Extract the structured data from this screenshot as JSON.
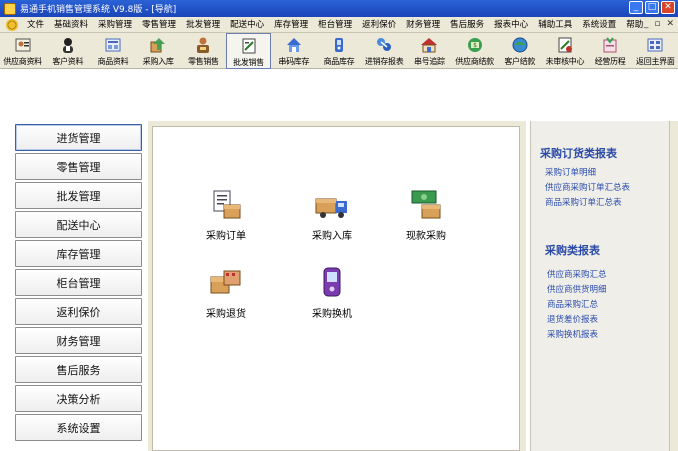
{
  "window": {
    "title": "易通手机销售管理系统  V9.8版 - [导航]"
  },
  "menu": [
    "文件",
    "基础资料",
    "采购管理",
    "零售管理",
    "批发管理",
    "配送中心",
    "库存管理",
    "柜台管理",
    "返利保价",
    "财务管理",
    "售后服务",
    "报表中心",
    "辅助工具",
    "系统设置",
    "帮助"
  ],
  "toolbar": [
    {
      "label": "供应商资料",
      "icon": "supplier-icon"
    },
    {
      "label": "客户资料",
      "icon": "customer-icon"
    },
    {
      "label": "商品资料",
      "icon": "product-icon"
    },
    {
      "label": "采购入库",
      "icon": "purchase-in-icon"
    },
    {
      "label": "零售销售",
      "icon": "retail-icon"
    },
    {
      "label": "批发销售",
      "icon": "wholesale-icon"
    },
    {
      "label": "串码库存",
      "icon": "serial-stock-icon"
    },
    {
      "label": "商品库存",
      "icon": "stock-icon"
    },
    {
      "label": "进销存报表",
      "icon": "report-icon"
    },
    {
      "label": "串号追踪",
      "icon": "serial-track-icon"
    },
    {
      "label": "供应商结款",
      "icon": "supplier-pay-icon"
    },
    {
      "label": "客户结款",
      "icon": "customer-pay-icon"
    },
    {
      "label": "未审核中心",
      "icon": "unaudited-icon"
    },
    {
      "label": "经营历程",
      "icon": "history-icon"
    },
    {
      "label": "返回主界面",
      "icon": "home-icon"
    }
  ],
  "nav": [
    "进货管理",
    "零售管理",
    "批发管理",
    "配送中心",
    "库存管理",
    "柜台管理",
    "返利保价",
    "财务管理",
    "售后服务",
    "决策分析",
    "系统设置"
  ],
  "functions": [
    {
      "label": "采购订单",
      "icon": "purchase-order-icon"
    },
    {
      "label": "采购入库",
      "icon": "purchase-in-truck-icon"
    },
    {
      "label": "现款采购",
      "icon": "cash-purchase-icon"
    },
    {
      "label": "采购退货",
      "icon": "purchase-return-icon"
    },
    {
      "label": "采购换机",
      "icon": "phone-exchange-icon"
    }
  ],
  "reports": {
    "group1_title": "采购订货类报表",
    "group1": [
      "采购订单明细",
      "供应商采购订单汇总表",
      "商品采购订单汇总表"
    ],
    "group2_title": "采购类报表",
    "group2": [
      "供应商采购汇总",
      "供应商供货明细",
      "商品采购汇总",
      "退货差价报表",
      "采购换机报表"
    ]
  },
  "colors": {
    "title_bar": "#1a45b8",
    "link": "#2a4cb0",
    "heading": "#2b4aa6",
    "panel_bg": "#ece9d8"
  }
}
